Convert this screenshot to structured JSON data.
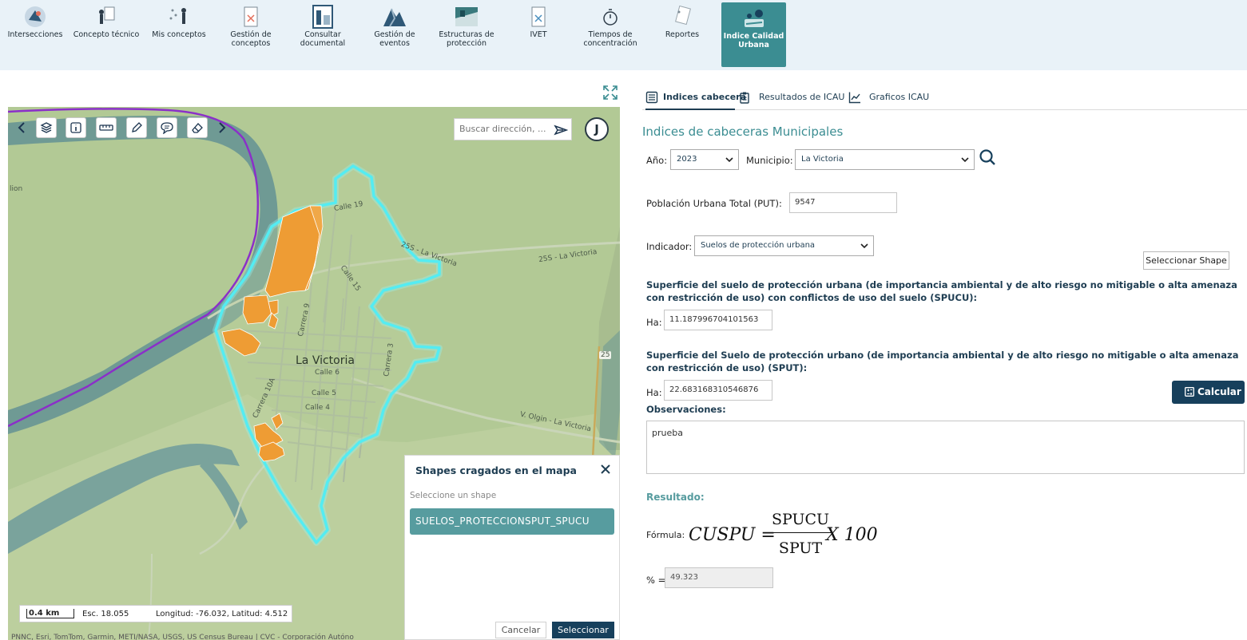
{
  "modules": [
    {
      "label": "Intersecciones",
      "icon": "intersections-icon"
    },
    {
      "label": "Concepto técnico",
      "icon": "technical-concept-icon"
    },
    {
      "label": "Mis conceptos",
      "icon": "my-concepts-icon"
    },
    {
      "label": "Gestión de\nconceptos",
      "icon": "concept-management-icon"
    },
    {
      "label": "Consultar\ndocumental",
      "icon": "document-query-icon"
    },
    {
      "label": "Gestión de eventos",
      "icon": "event-management-icon"
    },
    {
      "label": "Estructuras de\nprotección",
      "icon": "protection-structures-icon"
    },
    {
      "label": "IVET",
      "icon": "ivet-icon"
    },
    {
      "label": "Tiempos de\nconcentración",
      "icon": "concentration-times-icon"
    },
    {
      "label": "Reportes",
      "icon": "reports-icon"
    },
    {
      "label": "Indice Calidad\nUrbana",
      "icon": "urban-quality-index-icon",
      "active": true
    }
  ],
  "map": {
    "search_placeholder": "Buscar dirección, ...",
    "user_initial": "J",
    "city_label": "La Victoria",
    "labels": {
      "road_25s": "25S - La Victoria",
      "road_25s_b": "25S - La Victoria",
      "road_olgin": "V. Olgin - La Victoria",
      "calle19": "Calle 19",
      "calle15": "Calle 15",
      "calle6": "Calle 6",
      "calle5": "Calle 5",
      "calle4": "Calle 4",
      "carrera9": "Carrera 9",
      "carrera3": "Carrera 3",
      "carrera10a": "Carrera 10A",
      "road25": "25",
      "edge_left": "lion"
    },
    "scale": {
      "distance": "0.4 km",
      "scale_text": "Esc. 18.055",
      "coords": "Longitud: -76.032, Latitud: 4.512"
    },
    "attribution": "PNNC, Esri, TomTom, Garmin, METI/NASA, USGS, US Census Bureau | CVC - Corporación Autóno"
  },
  "popup": {
    "title": "Shapes cragados en el mapa",
    "subtitle": "Seleccione un shape",
    "shape_name": "SUELOS_PROTECCIONSPUT_SPUCU",
    "cancel": "Cancelar",
    "select": "Seleccionar"
  },
  "tabs": [
    {
      "label": "Indices cabecera",
      "icon": "list-icon",
      "active": true
    },
    {
      "label": "Resultados de ICAU",
      "icon": "clipboard-icon"
    },
    {
      "label": "Graficos ICAU",
      "icon": "line-chart-icon"
    }
  ],
  "panel": {
    "title": "Indices de cabeceras Municipales",
    "year_label": "Año:",
    "year_value": "2023",
    "municipio_label": "Municipio:",
    "municipio_value": "La Victoria",
    "put_label": "Población Urbana Total (PUT):",
    "put_value": "9547",
    "indicador_label": "Indicador:",
    "indicador_value": "Suelos de protección urbana",
    "select_shape": "Seleccionar Shape",
    "spucu_text": "Superficie del suelo de protección urbana (de importancia ambiental y de alto riesgo no mitigable o alta amenaza con restricción de uso) con conflictos de uso del suelo (SPUCU):",
    "ha_label1": "Ha:",
    "spucu_value": "11.187996704101563",
    "sput_text": "Superficie del Suelo de protección urbano (de importancia ambiental y de alto riesgo no mitigable o alta amenaza con restricción de uso) (SPUT):",
    "ha_label2": "Ha:",
    "sput_value": "22.683168310546876",
    "calc_label": "Calcular",
    "obs_label": "Observaciones:",
    "obs_value": "prueba",
    "result_label": "Resultado:",
    "formula_label": "Fórmula:",
    "formula_lhs": "CUSPU =",
    "formula_num": "SPUCU",
    "formula_den": "SPUT",
    "formula_rhs": "X 100",
    "pct_label": "% =",
    "pct_value": "49.323"
  },
  "colors": {
    "active_module": "#3b8d92",
    "primary_dark": "#17405c",
    "teal_text": "#3b8d92",
    "shape_orange": "#ee9c34",
    "boundary_cyan": "#35e6ee",
    "river": "#6f9a94",
    "boundary_purple": "#8b2fc9"
  }
}
